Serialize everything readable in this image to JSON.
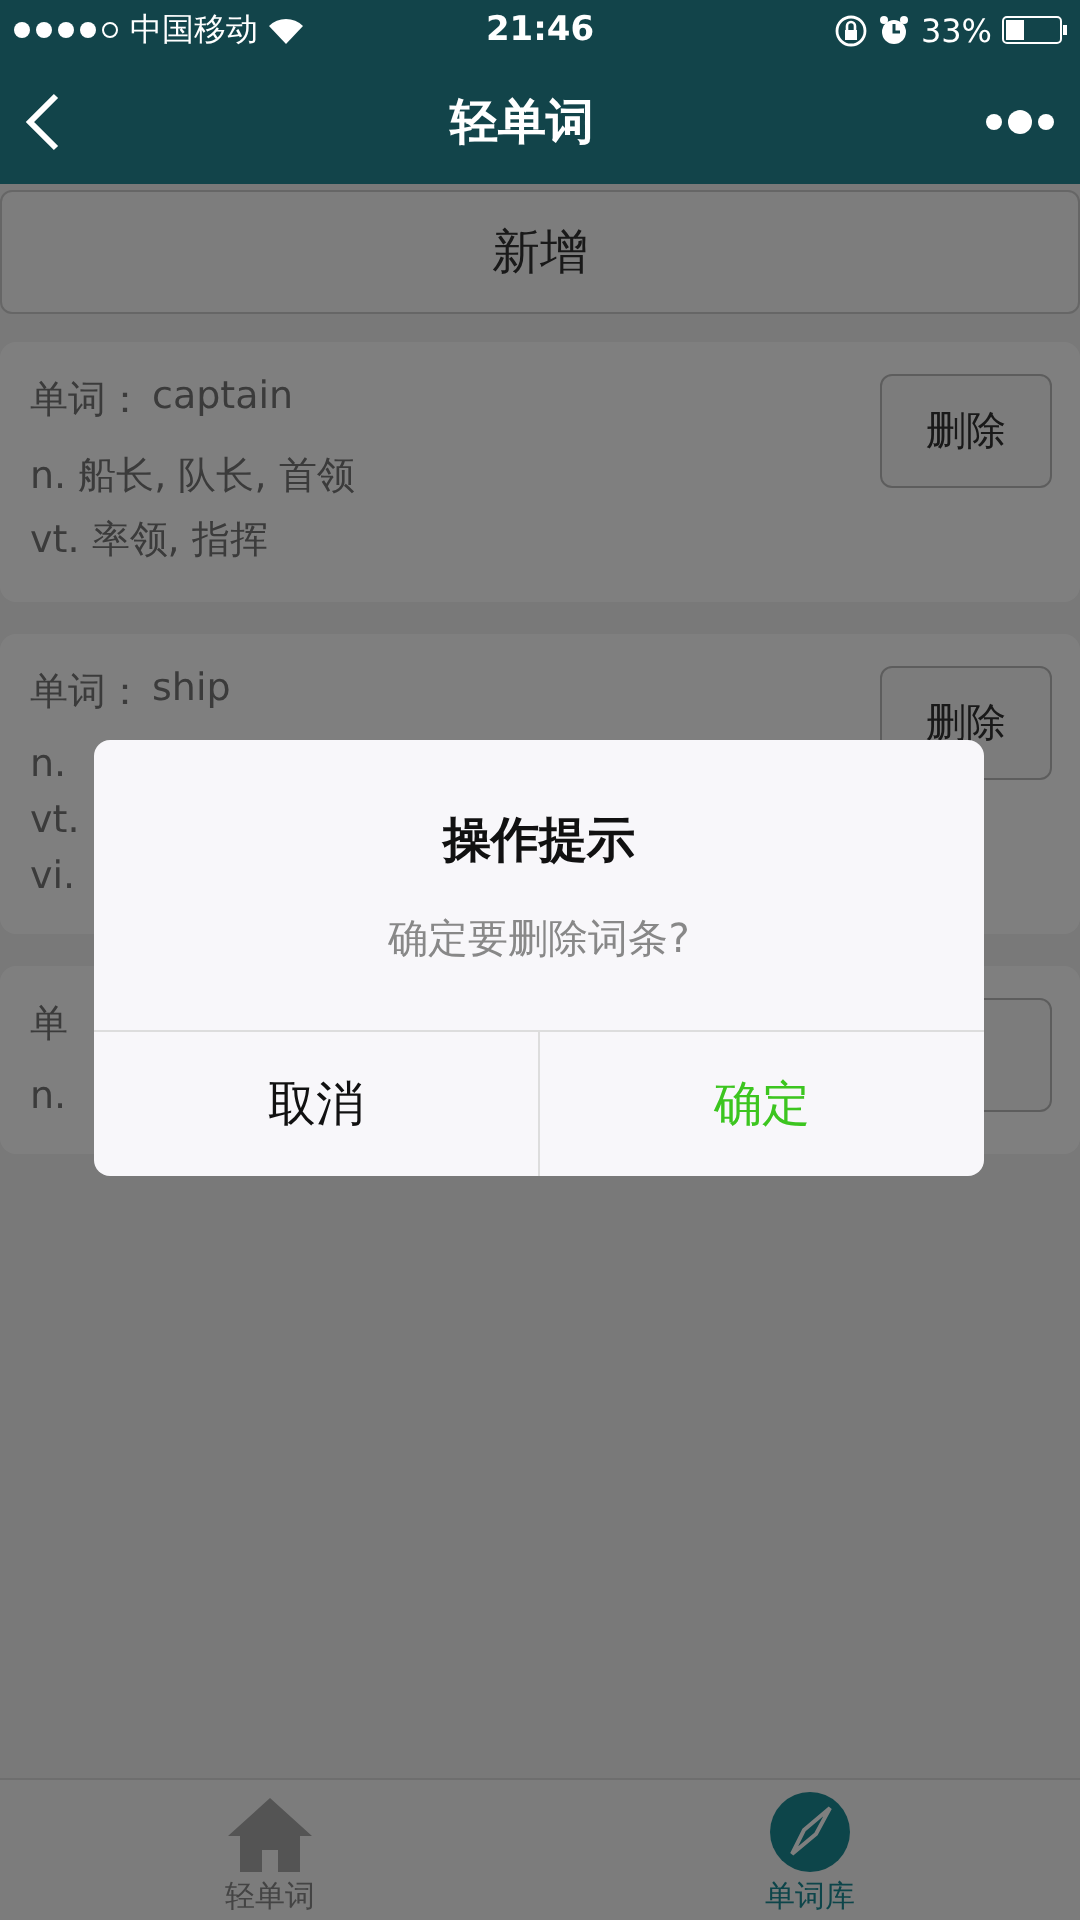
{
  "status_bar": {
    "carrier": "中国移动",
    "time": "21:46",
    "battery": "33%"
  },
  "nav": {
    "title": "轻单词"
  },
  "add_button": "新增",
  "words": [
    {
      "label": "单词：",
      "word": "captain",
      "meanings": [
        "n. 船长, 队长, 首领",
        "vt. 率领, 指挥"
      ],
      "delete": "删除"
    },
    {
      "label": "单词：",
      "word": "ship",
      "meanings": [
        "n.",
        "vt.",
        "vi."
      ],
      "delete": "删除"
    },
    {
      "label": "单",
      "meanings": [
        "n."
      ]
    }
  ],
  "dialog": {
    "title": "操作提示",
    "message": "确定要删除词条?",
    "buttons": [
      {
        "label": "取消",
        "kind": "cancel"
      },
      {
        "label": "确定",
        "kind": "confirm"
      }
    ]
  },
  "tab_bar": [
    {
      "label": "轻单词",
      "kind": "home",
      "selected": false
    },
    {
      "label": "单词库",
      "kind": "compass",
      "selected": true
    }
  ]
}
